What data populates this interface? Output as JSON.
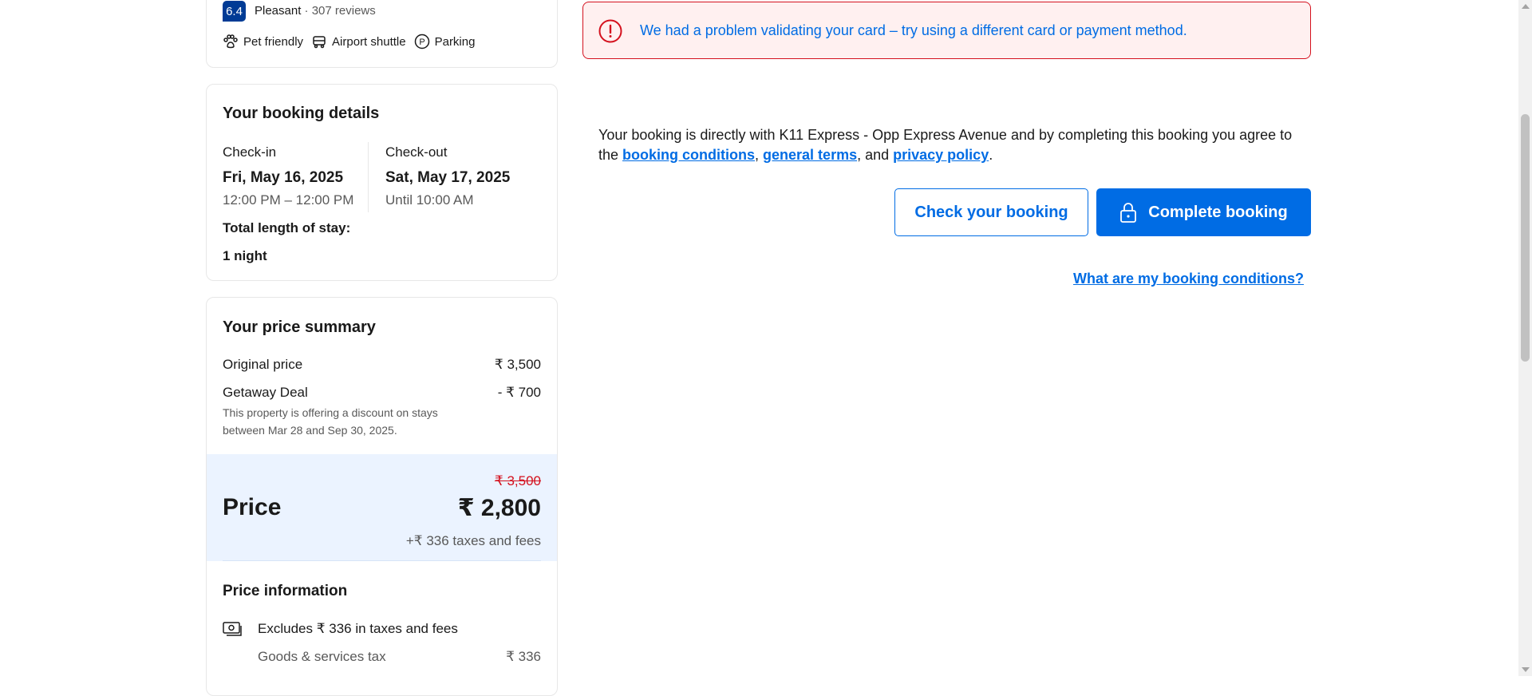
{
  "property": {
    "score": "6.4",
    "rating_word": "Pleasant",
    "separator": " · ",
    "reviews": "307 reviews",
    "facilities": [
      {
        "label": "Pet friendly",
        "icon": "paw-icon"
      },
      {
        "label": "Airport shuttle",
        "icon": "shuttle-icon"
      },
      {
        "label": "Parking",
        "icon": "parking-icon"
      }
    ]
  },
  "booking_details": {
    "title": "Your booking details",
    "checkin_label": "Check-in",
    "checkin_date": "Fri, May 16, 2025",
    "checkin_time": "12:00 PM – 12:00 PM",
    "checkout_label": "Check-out",
    "checkout_date": "Sat, May 17, 2025",
    "checkout_time": "Until 10:00 AM",
    "stay_label": "Total length of stay:",
    "stay_value": "1 night"
  },
  "price_summary": {
    "title": "Your price summary",
    "original_label": "Original price",
    "original_value": "₹ 3,500",
    "deal_label": "Getaway Deal",
    "deal_value": "- ₹ 700",
    "deal_note": "This property is offering a discount on stays between Mar 28 and Sep 30, 2025.",
    "price_label": "Price",
    "strike_price": "₹ 3,500",
    "final_price": "₹ 2,800",
    "taxes": "+₹ 336 taxes and fees"
  },
  "price_info": {
    "title": "Price information",
    "excludes": "Excludes ₹ 336 in taxes and fees",
    "gst_label": "Goods & services tax",
    "gst_value": "₹ 336"
  },
  "error": {
    "message": "We had a problem validating your card – try using a different card or payment method."
  },
  "agreement": {
    "line1": "Your booking is directly with K11 Express - Opp Express Avenue and by completing this booking you agree to",
    "the": "the ",
    "link1": "booking conditions",
    "comma": ", ",
    "link2": "general terms",
    "and": ", and ",
    "link3": "privacy policy",
    "period": "."
  },
  "actions": {
    "check_label": "Check your booking",
    "complete_label": "Complete booking",
    "conditions_link": "What are my booking conditions?"
  },
  "colors": {
    "brand_blue": "#006ce4",
    "score_blue": "#003b95",
    "error_red": "#d4111e",
    "error_bg": "#fff0f0",
    "price_bg": "#ebf3ff"
  }
}
